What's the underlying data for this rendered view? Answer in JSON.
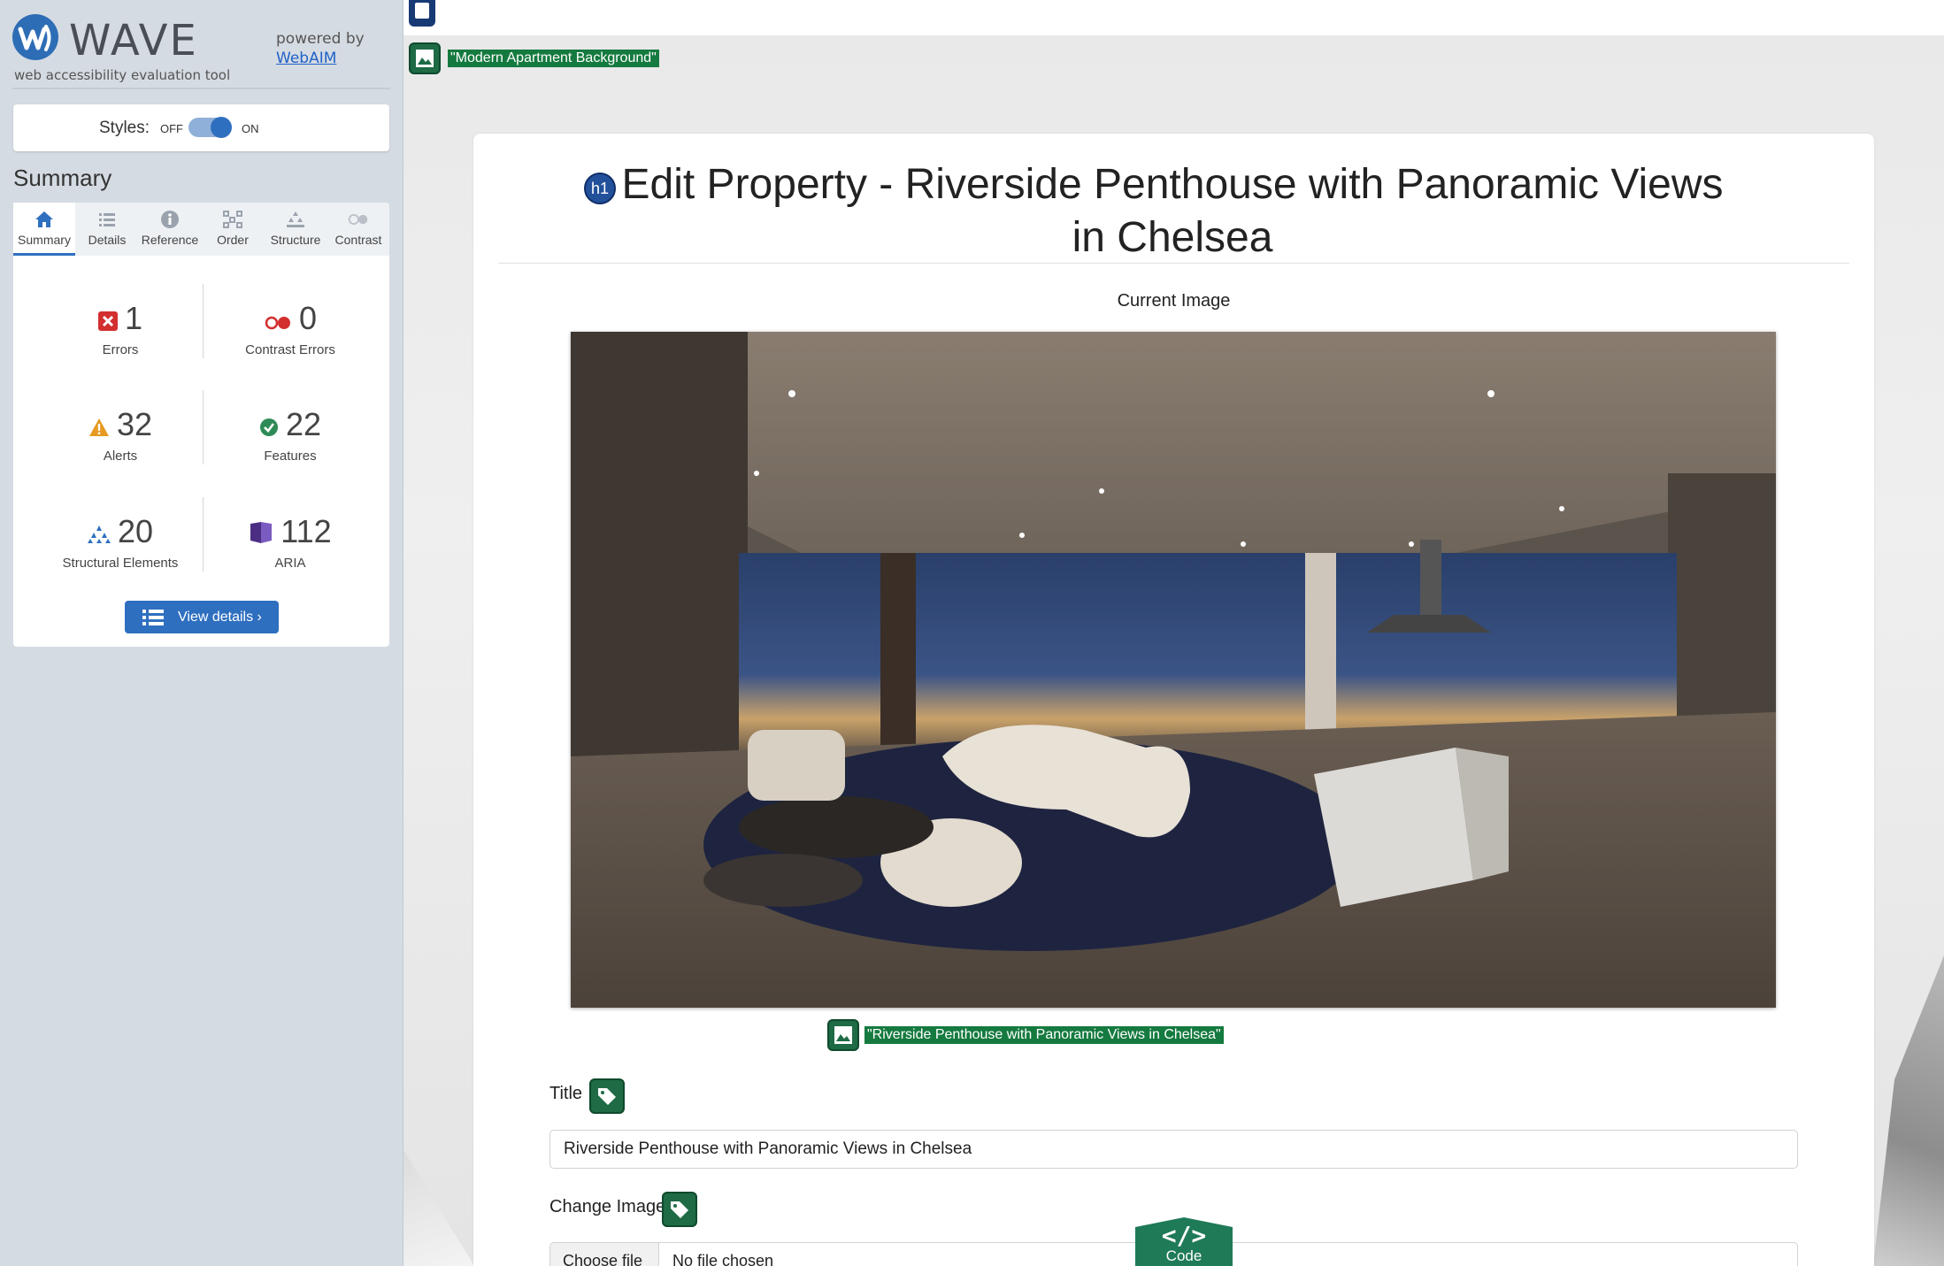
{
  "wave": {
    "brand": "WAVE",
    "tagline": "web accessibility evaluation tool",
    "powered_by": "powered by",
    "powered_by_link": "WebAIM",
    "styles_label": "Styles:",
    "styles_off": "OFF",
    "styles_on": "ON",
    "styles_enabled": true,
    "summary_heading": "Summary",
    "tabs": [
      {
        "label": "Summary",
        "icon": "home-icon",
        "active": true
      },
      {
        "label": "Details",
        "icon": "list-icon",
        "active": false
      },
      {
        "label": "Reference",
        "icon": "info-icon",
        "active": false
      },
      {
        "label": "Order",
        "icon": "order-icon",
        "active": false
      },
      {
        "label": "Structure",
        "icon": "structure-icon",
        "active": false
      },
      {
        "label": "Contrast",
        "icon": "contrast-icon",
        "active": false
      }
    ],
    "stats": {
      "errors": {
        "value": "1",
        "label": "Errors",
        "icon": "error-icon"
      },
      "contrast_errors": {
        "value": "0",
        "label": "Contrast Errors",
        "icon": "contrast-error-icon"
      },
      "alerts": {
        "value": "32",
        "label": "Alerts",
        "icon": "alert-icon"
      },
      "features": {
        "value": "22",
        "label": "Features",
        "icon": "feature-icon"
      },
      "structural": {
        "value": "20",
        "label": "Structural Elements",
        "icon": "structure-icon"
      },
      "aria": {
        "value": "112",
        "label": "ARIA",
        "icon": "aria-icon"
      }
    },
    "view_details": "View details ›",
    "colors": {
      "accent": "#2f6fc0",
      "error": "#d32f2f",
      "alert": "#e69a1f",
      "feature": "#2e8b57",
      "aria": "#4b2e83"
    }
  },
  "page": {
    "bg_alt": "\"Modern Apartment Background\"",
    "title": "Edit Property - Riverside Penthouse with Panoramic Views in Chelsea",
    "h1_badge": "h1",
    "current_image_label": "Current Image",
    "image_alt": "\"Riverside Penthouse with Panoramic Views in Chelsea\"",
    "title_label": "Title",
    "title_value": "Riverside Penthouse with Panoramic Views in Chelsea",
    "change_image_label": "Change Image",
    "choose_file": "Choose file",
    "no_file": "No file chosen",
    "code_tab": "Code",
    "code_glyph": "</>"
  }
}
